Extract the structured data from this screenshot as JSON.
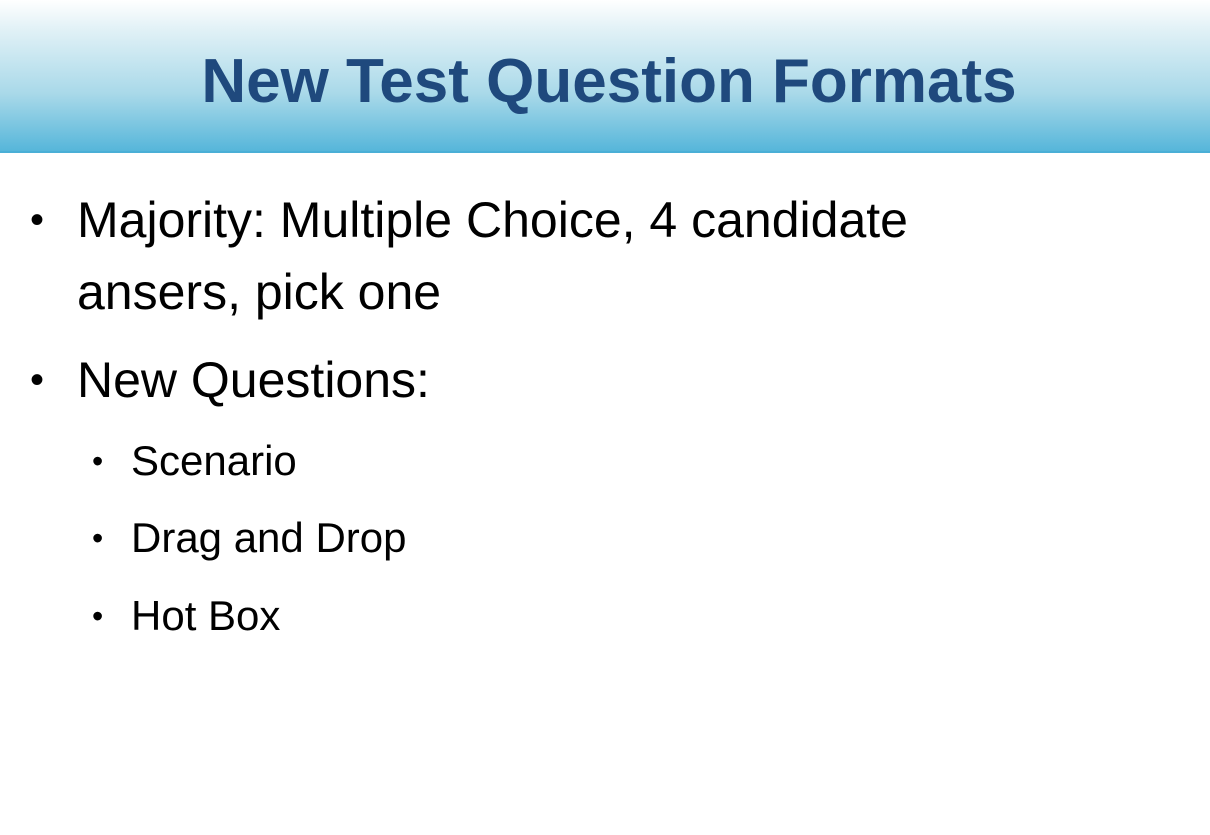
{
  "slide": {
    "title": "New Test Question Formats",
    "bullets": [
      {
        "line1": "Majority: Multiple Choice, 4 candidate",
        "line2": "ansers, pick one"
      },
      {
        "line1": "New Questions:",
        "sub": [
          "Scenario",
          "Drag and Drop",
          "Hot Box"
        ]
      }
    ],
    "bullet_glyph": "•"
  },
  "colors": {
    "title": "#1f497d",
    "band_top": "#ffffff",
    "band_bottom": "#56b6da",
    "text": "#000000"
  }
}
